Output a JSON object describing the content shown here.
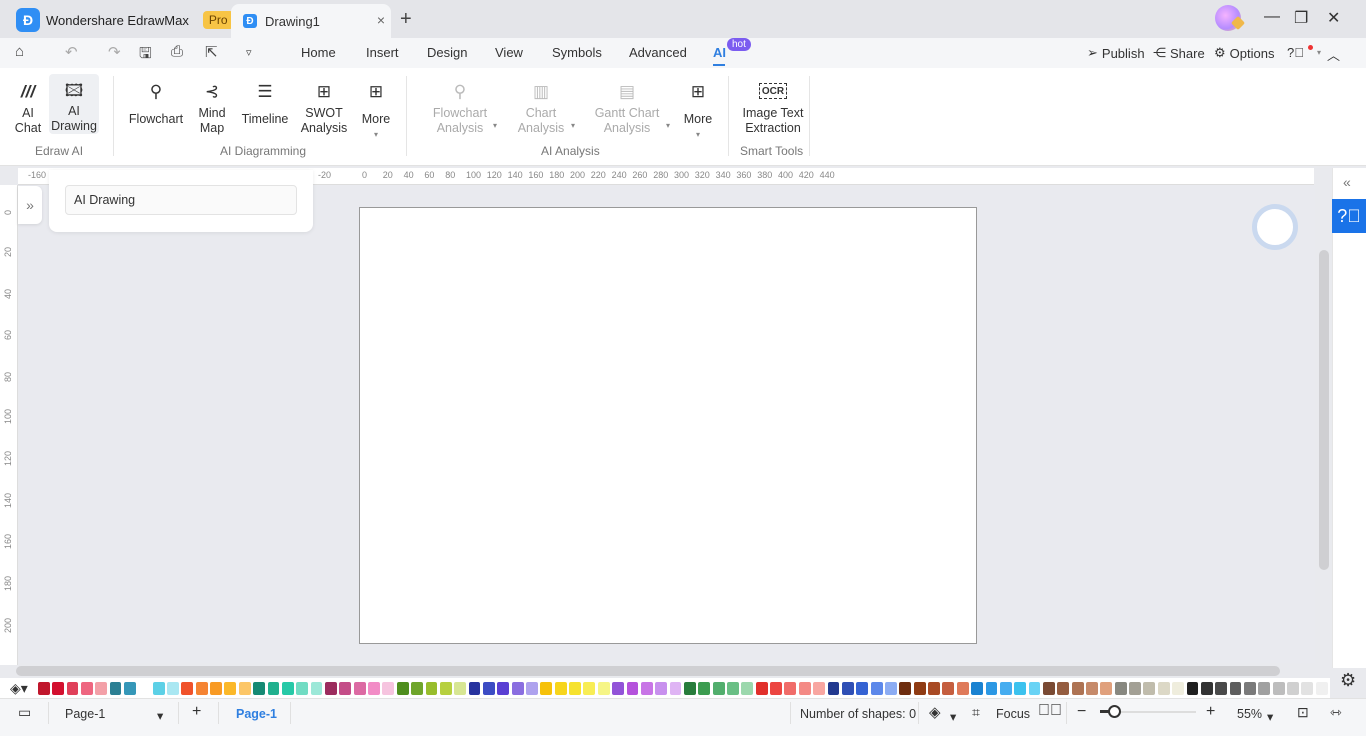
{
  "title_bar": {
    "app_name": "Wondershare EdrawMax",
    "app_badge": "Pro",
    "document_tab": "Drawing1",
    "new_tab_icon": "+",
    "close_tab_icon": "×",
    "window_controls": {
      "minimize": "—",
      "restore": "❐",
      "close": "✕"
    }
  },
  "menu": {
    "items": [
      "Home",
      "Insert",
      "Design",
      "View",
      "Symbols",
      "Advanced",
      "AI"
    ],
    "active": "AI",
    "active_badge": "hot",
    "right": {
      "publish": "Publish",
      "share": "Share",
      "options": "Options"
    }
  },
  "ribbon": {
    "groups": [
      {
        "label": "Edraw AI",
        "buttons": [
          {
            "label1": "AI",
            "label2": "Chat"
          },
          {
            "label1": "AI",
            "label2": "Drawing"
          }
        ]
      },
      {
        "label": "AI Diagramming",
        "buttons": [
          {
            "label1": "Flowchart",
            "label2": ""
          },
          {
            "label1": "Mind",
            "label2": "Map"
          },
          {
            "label1": "Timeline",
            "label2": ""
          },
          {
            "label1": "SWOT",
            "label2": "Analysis"
          },
          {
            "label1": "More",
            "label2": ""
          }
        ]
      },
      {
        "label": "AI Analysis",
        "buttons": [
          {
            "label1": "Flowchart",
            "label2": "Analysis"
          },
          {
            "label1": "Chart",
            "label2": "Analysis"
          },
          {
            "label1": "Gantt Chart",
            "label2": "Analysis"
          },
          {
            "label1": "More",
            "label2": ""
          }
        ]
      },
      {
        "label": "Smart Tools",
        "buttons": [
          {
            "label1": "Image Text",
            "label2": "Extraction"
          }
        ]
      }
    ]
  },
  "rulers": {
    "horizontal": [
      "-160",
      "-20",
      "0",
      "20",
      "40",
      "60",
      "80",
      "100",
      "120",
      "140",
      "160",
      "180",
      "200",
      "220",
      "240",
      "260",
      "280",
      "300",
      "320",
      "340",
      "360",
      "380",
      "400",
      "420",
      "440"
    ],
    "vertical": [
      "0",
      "20",
      "40",
      "60",
      "80",
      "100",
      "120",
      "140",
      "160",
      "180",
      "200"
    ]
  },
  "side_panel": {
    "title": "AI Drawing"
  },
  "palette": {
    "colors": [
      "#c0162c",
      "#d3102f",
      "#e0405a",
      "#ee6680",
      "#f3a0a8",
      "#2c7f93",
      "#3597b8",
      "#ffffff",
      "#5cd0e6",
      "#a9e7f2",
      "#f0522b",
      "#f58433",
      "#f89a24",
      "#fbb829",
      "#fcc667",
      "#168a74",
      "#20b08e",
      "#27c9a7",
      "#71dcc3",
      "#9ce8d8",
      "#9c2c5e",
      "#c44d88",
      "#dc6aa3",
      "#f28cc6",
      "#f6c4df",
      "#4f8e1e",
      "#6fa52b",
      "#98bd2c",
      "#b7d03f",
      "#d7e693",
      "#27329e",
      "#3c4cc4",
      "#5a3fd3",
      "#8a6ee0",
      "#aea2ee",
      "#f6c10a",
      "#f7d51c",
      "#f6e22e",
      "#f8ed55",
      "#f6f586",
      "#9253d8",
      "#b552dc",
      "#c875e6",
      "#c890ee",
      "#dfb4f4",
      "#287d3c",
      "#3c9c50",
      "#52ae6d",
      "#6abf85",
      "#9cd8ad",
      "#e1302b",
      "#ec4541",
      "#f06c69",
      "#f48a85",
      "#f8a6a1",
      "#22398f",
      "#2f4fb5",
      "#3563d3",
      "#5d88ea",
      "#8cacf3",
      "#6e2d0f",
      "#8f3b13",
      "#a84a24",
      "#c55e3f",
      "#df7a5a",
      "#1a82d1",
      "#2c98e4",
      "#46adf0",
      "#3cc2ee",
      "#69d3f5",
      "#7a4a33",
      "#955d40",
      "#ae7353",
      "#c68a6a",
      "#e0a07c",
      "#888880",
      "#a3a095",
      "#c0bcac",
      "#dcd8c6",
      "#efeddd",
      "#1f1f1f",
      "#333333",
      "#4a4a4a",
      "#5e5e5e",
      "#7a7a7a",
      "#a0a0a0",
      "#bdbdbd",
      "#d0d0d0",
      "#e2e2e2",
      "#f0f0f0"
    ]
  },
  "status_bar": {
    "page_selector": "Page-1",
    "active_page_tab": "Page-1",
    "add_page": "+",
    "shape_count_label": "Number of shapes: 0",
    "focus_label": "Focus",
    "zoom_minus": "−",
    "zoom_plus": "+",
    "zoom_level": "55%",
    "zoom_fraction": 0.1
  },
  "colors": {
    "accent": "#2f7fe0",
    "help_button": "#1a73e8",
    "hot_badge": "#7b5cf0",
    "pro_badge": "#f7c445"
  }
}
